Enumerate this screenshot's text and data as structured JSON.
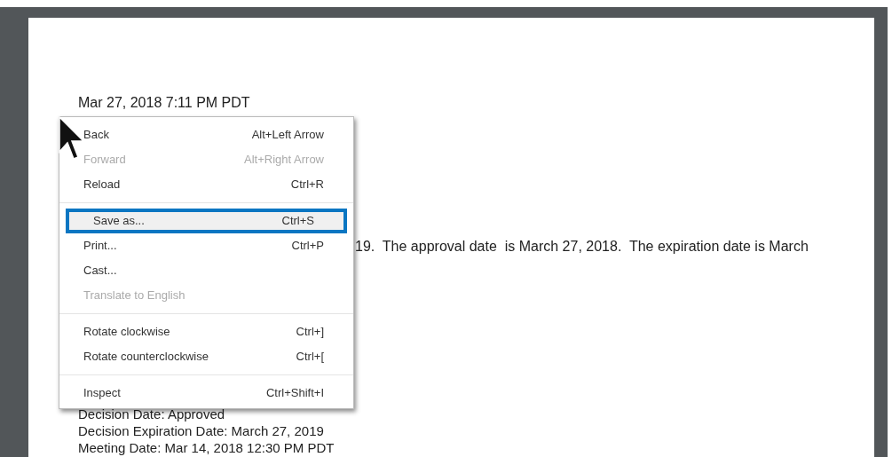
{
  "document": {
    "timestamp": "Mar 27, 2018 7:11 PM PDT",
    "paragraph_fragment": "19.  The approval date  is March 27, 2018.  The expiration date is March",
    "lines": [
      "Decision Date: Approved",
      "Decision Expiration Date: March 27, 2019",
      "Meeting Date: Mar 14, 2018 12:30 PM PDT"
    ]
  },
  "context_menu": {
    "items": [
      {
        "kind": "item",
        "label": "Back",
        "shortcut": "Alt+Left Arrow",
        "disabled": false,
        "selected": false
      },
      {
        "kind": "item",
        "label": "Forward",
        "shortcut": "Alt+Right Arrow",
        "disabled": true,
        "selected": false
      },
      {
        "kind": "item",
        "label": "Reload",
        "shortcut": "Ctrl+R",
        "disabled": false,
        "selected": false
      },
      {
        "kind": "separator"
      },
      {
        "kind": "item",
        "label": "Save as...",
        "shortcut": "Ctrl+S",
        "disabled": false,
        "selected": true
      },
      {
        "kind": "item",
        "label": "Print...",
        "shortcut": "Ctrl+P",
        "disabled": false,
        "selected": false
      },
      {
        "kind": "item",
        "label": "Cast...",
        "disabled": false,
        "selected": false
      },
      {
        "kind": "item",
        "label": "Translate to English",
        "disabled": true,
        "selected": false
      },
      {
        "kind": "separator"
      },
      {
        "kind": "item",
        "label": "Rotate clockwise",
        "shortcut": "Ctrl+]",
        "disabled": false,
        "selected": false
      },
      {
        "kind": "item",
        "label": "Rotate counterclockwise",
        "shortcut": "Ctrl+[",
        "disabled": false,
        "selected": false
      },
      {
        "kind": "separator"
      },
      {
        "kind": "item",
        "label": "Inspect",
        "shortcut": "Ctrl+Shift+I",
        "disabled": false,
        "selected": false
      }
    ]
  }
}
